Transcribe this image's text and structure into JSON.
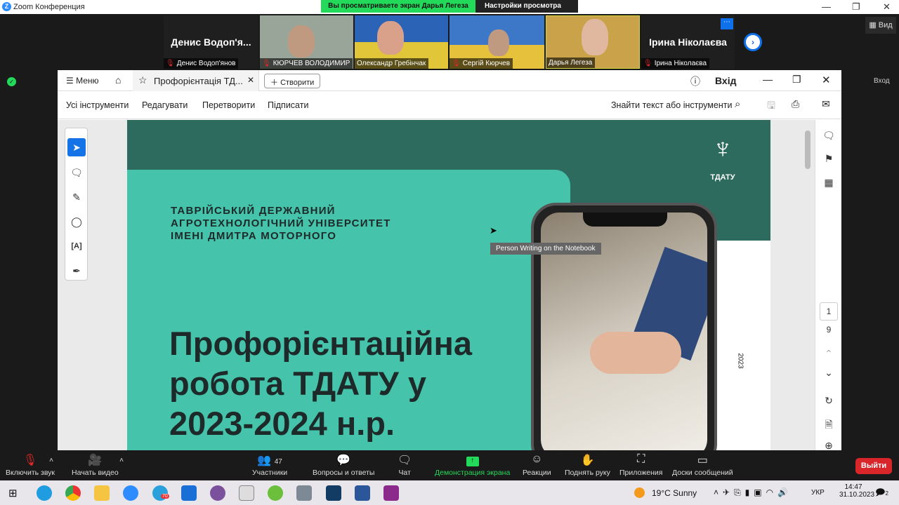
{
  "window": {
    "title": "Zoom Конференция",
    "logo_letter": "Z"
  },
  "banner": {
    "sharing": "Вы просматриваете экран Дарья Легеза",
    "view_options": "Настройки просмотра"
  },
  "view_button": "Вид",
  "exit_top": "Вход",
  "participants": [
    {
      "display": "Денис Водоп'я...",
      "name": "Денис Водоп'янов",
      "muted": true,
      "video": false
    },
    {
      "name": "КЮРЧЕВ ВОЛОДИМИР",
      "muted": true,
      "video": true
    },
    {
      "name": "Олександр Гребінчак",
      "muted": false,
      "video": true
    },
    {
      "name": "Сергій Кюрчев",
      "muted": true,
      "video": true
    },
    {
      "name": "Дарья Легеза",
      "muted": false,
      "video": true
    },
    {
      "display": "Ірина Ніколаєва",
      "name": "Ірина Ніколаєва",
      "muted": true,
      "video": false
    }
  ],
  "acrobat": {
    "menu": "Меню",
    "tab_title": "Профорієнтація ТД...",
    "create": "Створити",
    "signin": "Вхід",
    "toolbar": [
      "Усі інструменти",
      "Редагувати",
      "Перетворити",
      "Підписати"
    ],
    "search": "Знайти текст або інструменти",
    "page_current": "1",
    "page_total": "9"
  },
  "slide": {
    "university": [
      "ТАВРІЙСЬКИЙ ДЕРЖАВНИЙ",
      "АГРОТЕХНОЛОГІЧНИЙ УНІВЕРСИТЕТ",
      "ІМЕНІ ДМИТРА МОТОРНОГО"
    ],
    "title": [
      "Профорієнтаційна",
      "робота ТДАТУ у",
      "2023-2024 н.р."
    ],
    "logo_text": "ТДАТУ",
    "year": "2023",
    "tooltip": "Person Writing on the Notebook",
    "colors": {
      "dark": "#2e6b5f",
      "teal": "#45c4ab"
    }
  },
  "zoombar": {
    "unmute": "Включить звук",
    "video": "Начать видео",
    "participants": "Участники",
    "participants_count": "47",
    "qa": "Вопросы и ответы",
    "chat": "Чат",
    "share": "Демонстрация экрана",
    "reactions": "Реакции",
    "raise": "Поднять руку",
    "apps": "Приложения",
    "whiteboards": "Доски сообщений",
    "leave": "Выйти"
  },
  "taskbar": {
    "weather": "19°C  Sunny",
    "lang": "УКР",
    "time": "14:47",
    "date": "31.10.2023",
    "telegram_badge": "70",
    "notif": "2"
  }
}
